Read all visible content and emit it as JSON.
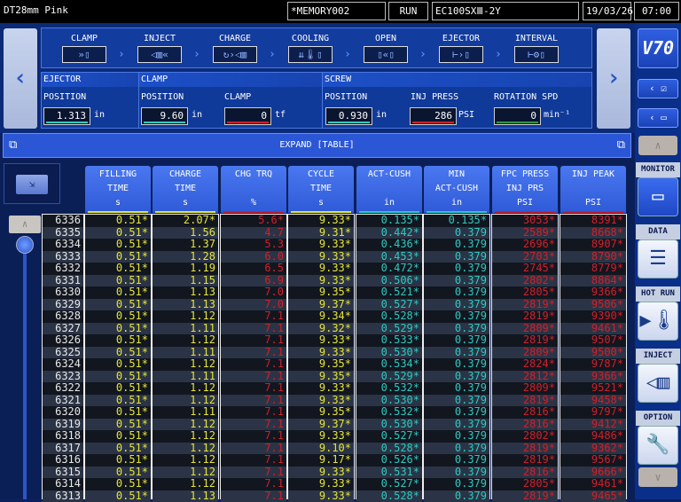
{
  "topbar": {
    "title": "DT28mm Pink",
    "memory": "*MEMORY002",
    "status": "RUN",
    "machine": "EC100SXⅢ-2Y",
    "date": "19/03/26",
    "time": "07:00"
  },
  "process": {
    "steps": [
      {
        "label": "CLAMP",
        "icon": "clamp-icon",
        "glyph": "»▯"
      },
      {
        "label": "INJECT",
        "icon": "inject-icon",
        "glyph": "◁▥«"
      },
      {
        "label": "CHARGE",
        "icon": "charge-icon",
        "glyph": "↻›◁▥"
      },
      {
        "label": "COOLING",
        "icon": "cooling-icon",
        "glyph": "⇊🌡▯"
      },
      {
        "label": "OPEN",
        "icon": "open-icon",
        "glyph": "▯«▯"
      },
      {
        "label": "EJECTOR",
        "icon": "ejector-icon",
        "glyph": "⊢›▯"
      },
      {
        "label": "INTERVAL",
        "icon": "interval-icon",
        "glyph": "⊢⚙▯"
      }
    ]
  },
  "params": {
    "ejector": {
      "title": "EJECTOR",
      "position_label": "POSITION",
      "position": "1.313",
      "position_unit": "in"
    },
    "clamp": {
      "title": "CLAMP",
      "position_label": "POSITION",
      "position": "9.60",
      "position_unit": "in",
      "clamp_label": "CLAMP",
      "clamp": "0",
      "clamp_unit": "tf"
    },
    "screw": {
      "title": "SCREW",
      "position_label": "POSITION",
      "position": "0.930",
      "position_unit": "in",
      "inj_press_label": "INJ PRESS",
      "inj_press": "286",
      "inj_press_unit": "PSI",
      "rotation_label": "ROTATION SPD",
      "rotation": "0",
      "rotation_unit": "min⁻¹"
    }
  },
  "expand": {
    "label": "EXPAND [TABLE]"
  },
  "sidebar": {
    "logo": "V70",
    "items": [
      {
        "label": "MONITOR",
        "icon": "monitor-icon",
        "active": true
      },
      {
        "label": "DATA",
        "icon": "database-icon"
      },
      {
        "label": "HOT RUN",
        "icon": "hot-runner-icon"
      },
      {
        "label": "INJECT",
        "icon": "inject-screw-icon"
      },
      {
        "label": "OPTION",
        "icon": "wrench-icon"
      }
    ]
  },
  "colors": {
    "yellow": "#e4e43c",
    "cyan": "#2fc9c0",
    "red": "#d0202a",
    "bg": "#0c2060",
    "accent": "#2b57d6"
  },
  "table": {
    "columns": [
      {
        "l1": "FILLING",
        "l2": "TIME",
        "unit": "s",
        "color": "#e4e43c"
      },
      {
        "l1": "CHARGE",
        "l2": "TIME",
        "unit": "s",
        "color": "#e4e43c"
      },
      {
        "l1": "CHG TRQ",
        "l2": "",
        "unit": "%",
        "color": "#d0202a"
      },
      {
        "l1": "CYCLE",
        "l2": "TIME",
        "unit": "s",
        "color": "#e4e43c"
      },
      {
        "l1": "ACT-CUSH",
        "l2": "",
        "unit": "in",
        "color": "#2fc9c0"
      },
      {
        "l1": "MIN",
        "l2": "ACT-CUSH",
        "unit": "in",
        "color": "#2fc9c0"
      },
      {
        "l1": "FPC PRESS",
        "l2": "INJ PRS",
        "unit": "PSI",
        "color": "#d0202a"
      },
      {
        "l1": "INJ PEAK",
        "l2": "",
        "unit": "PSI",
        "color": "#d0202a"
      }
    ],
    "rows": [
      [
        "6336",
        "0.51*",
        "2.07*",
        "5.6*",
        "9.33*",
        "0.135*",
        "0.135*",
        "3053*",
        "8391*"
      ],
      [
        "6335",
        "0.51*",
        "1.56",
        "4.7",
        "9.31*",
        "0.442*",
        "0.379",
        "2589*",
        "8668*"
      ],
      [
        "6334",
        "0.51*",
        "1.37",
        "5.3",
        "9.33*",
        "0.436*",
        "0.379",
        "2696*",
        "8907*"
      ],
      [
        "6333",
        "0.51*",
        "1.28",
        "6.0",
        "9.33*",
        "0.453*",
        "0.379",
        "2703*",
        "8790*"
      ],
      [
        "6332",
        "0.51*",
        "1.19",
        "6.5",
        "9.33*",
        "0.472*",
        "0.379",
        "2745*",
        "8779*"
      ],
      [
        "6331",
        "0.51*",
        "1.15",
        "6.9",
        "9.33*",
        "0.506*",
        "0.379",
        "2802*",
        "8864*"
      ],
      [
        "6330",
        "0.51*",
        "1.13",
        "7.0",
        "9.35*",
        "0.521*",
        "0.379",
        "2805*",
        "9366*"
      ],
      [
        "6329",
        "0.51*",
        "1.13",
        "7.0",
        "9.37*",
        "0.527*",
        "0.379",
        "2819*",
        "9506*"
      ],
      [
        "6328",
        "0.51*",
        "1.12",
        "7.1",
        "9.34*",
        "0.528*",
        "0.379",
        "2819*",
        "9390*"
      ],
      [
        "6327",
        "0.51*",
        "1.11",
        "7.1",
        "9.32*",
        "0.529*",
        "0.379",
        "2809*",
        "9461*"
      ],
      [
        "6326",
        "0.51*",
        "1.12",
        "7.1",
        "9.33*",
        "0.533*",
        "0.379",
        "2819*",
        "9507*"
      ],
      [
        "6325",
        "0.51*",
        "1.11",
        "7.1",
        "9.33*",
        "0.530*",
        "0.379",
        "2809*",
        "9500*"
      ],
      [
        "6324",
        "0.51*",
        "1.12",
        "7.1",
        "9.35*",
        "0.534*",
        "0.379",
        "2824*",
        "9787*"
      ],
      [
        "6323",
        "0.51*",
        "1.11",
        "7.1",
        "9.35*",
        "0.529*",
        "0.379",
        "2812*",
        "9366*"
      ],
      [
        "6322",
        "0.51*",
        "1.12",
        "7.1",
        "9.33*",
        "0.532*",
        "0.379",
        "2809*",
        "9521*"
      ],
      [
        "6321",
        "0.51*",
        "1.12",
        "7.1",
        "9.33*",
        "0.530*",
        "0.379",
        "2819*",
        "9458*"
      ],
      [
        "6320",
        "0.51*",
        "1.11",
        "7.1",
        "9.35*",
        "0.532*",
        "0.379",
        "2816*",
        "9797*"
      ],
      [
        "6319",
        "0.51*",
        "1.12",
        "7.1",
        "9.37*",
        "0.530*",
        "0.379",
        "2816*",
        "9412*"
      ],
      [
        "6318",
        "0.51*",
        "1.12",
        "7.1",
        "9.33*",
        "0.527*",
        "0.379",
        "2802*",
        "9486*"
      ],
      [
        "6317",
        "0.51*",
        "1.12",
        "7.1",
        "9.10*",
        "0.528*",
        "0.379",
        "2819*",
        "9362*"
      ],
      [
        "6316",
        "0.51*",
        "1.12",
        "7.1",
        "9.17*",
        "0.526*",
        "0.379",
        "2819*",
        "9567*"
      ],
      [
        "6315",
        "0.51*",
        "1.12",
        "7.1",
        "9.33*",
        "0.531*",
        "0.379",
        "2816*",
        "9666*"
      ],
      [
        "6314",
        "0.51*",
        "1.12",
        "7.1",
        "9.33*",
        "0.527*",
        "0.379",
        "2805*",
        "9461*"
      ],
      [
        "6313",
        "0.51*",
        "1.13",
        "7.1",
        "9.33*",
        "0.528*",
        "0.379",
        "2819*",
        "9465*"
      ]
    ]
  }
}
